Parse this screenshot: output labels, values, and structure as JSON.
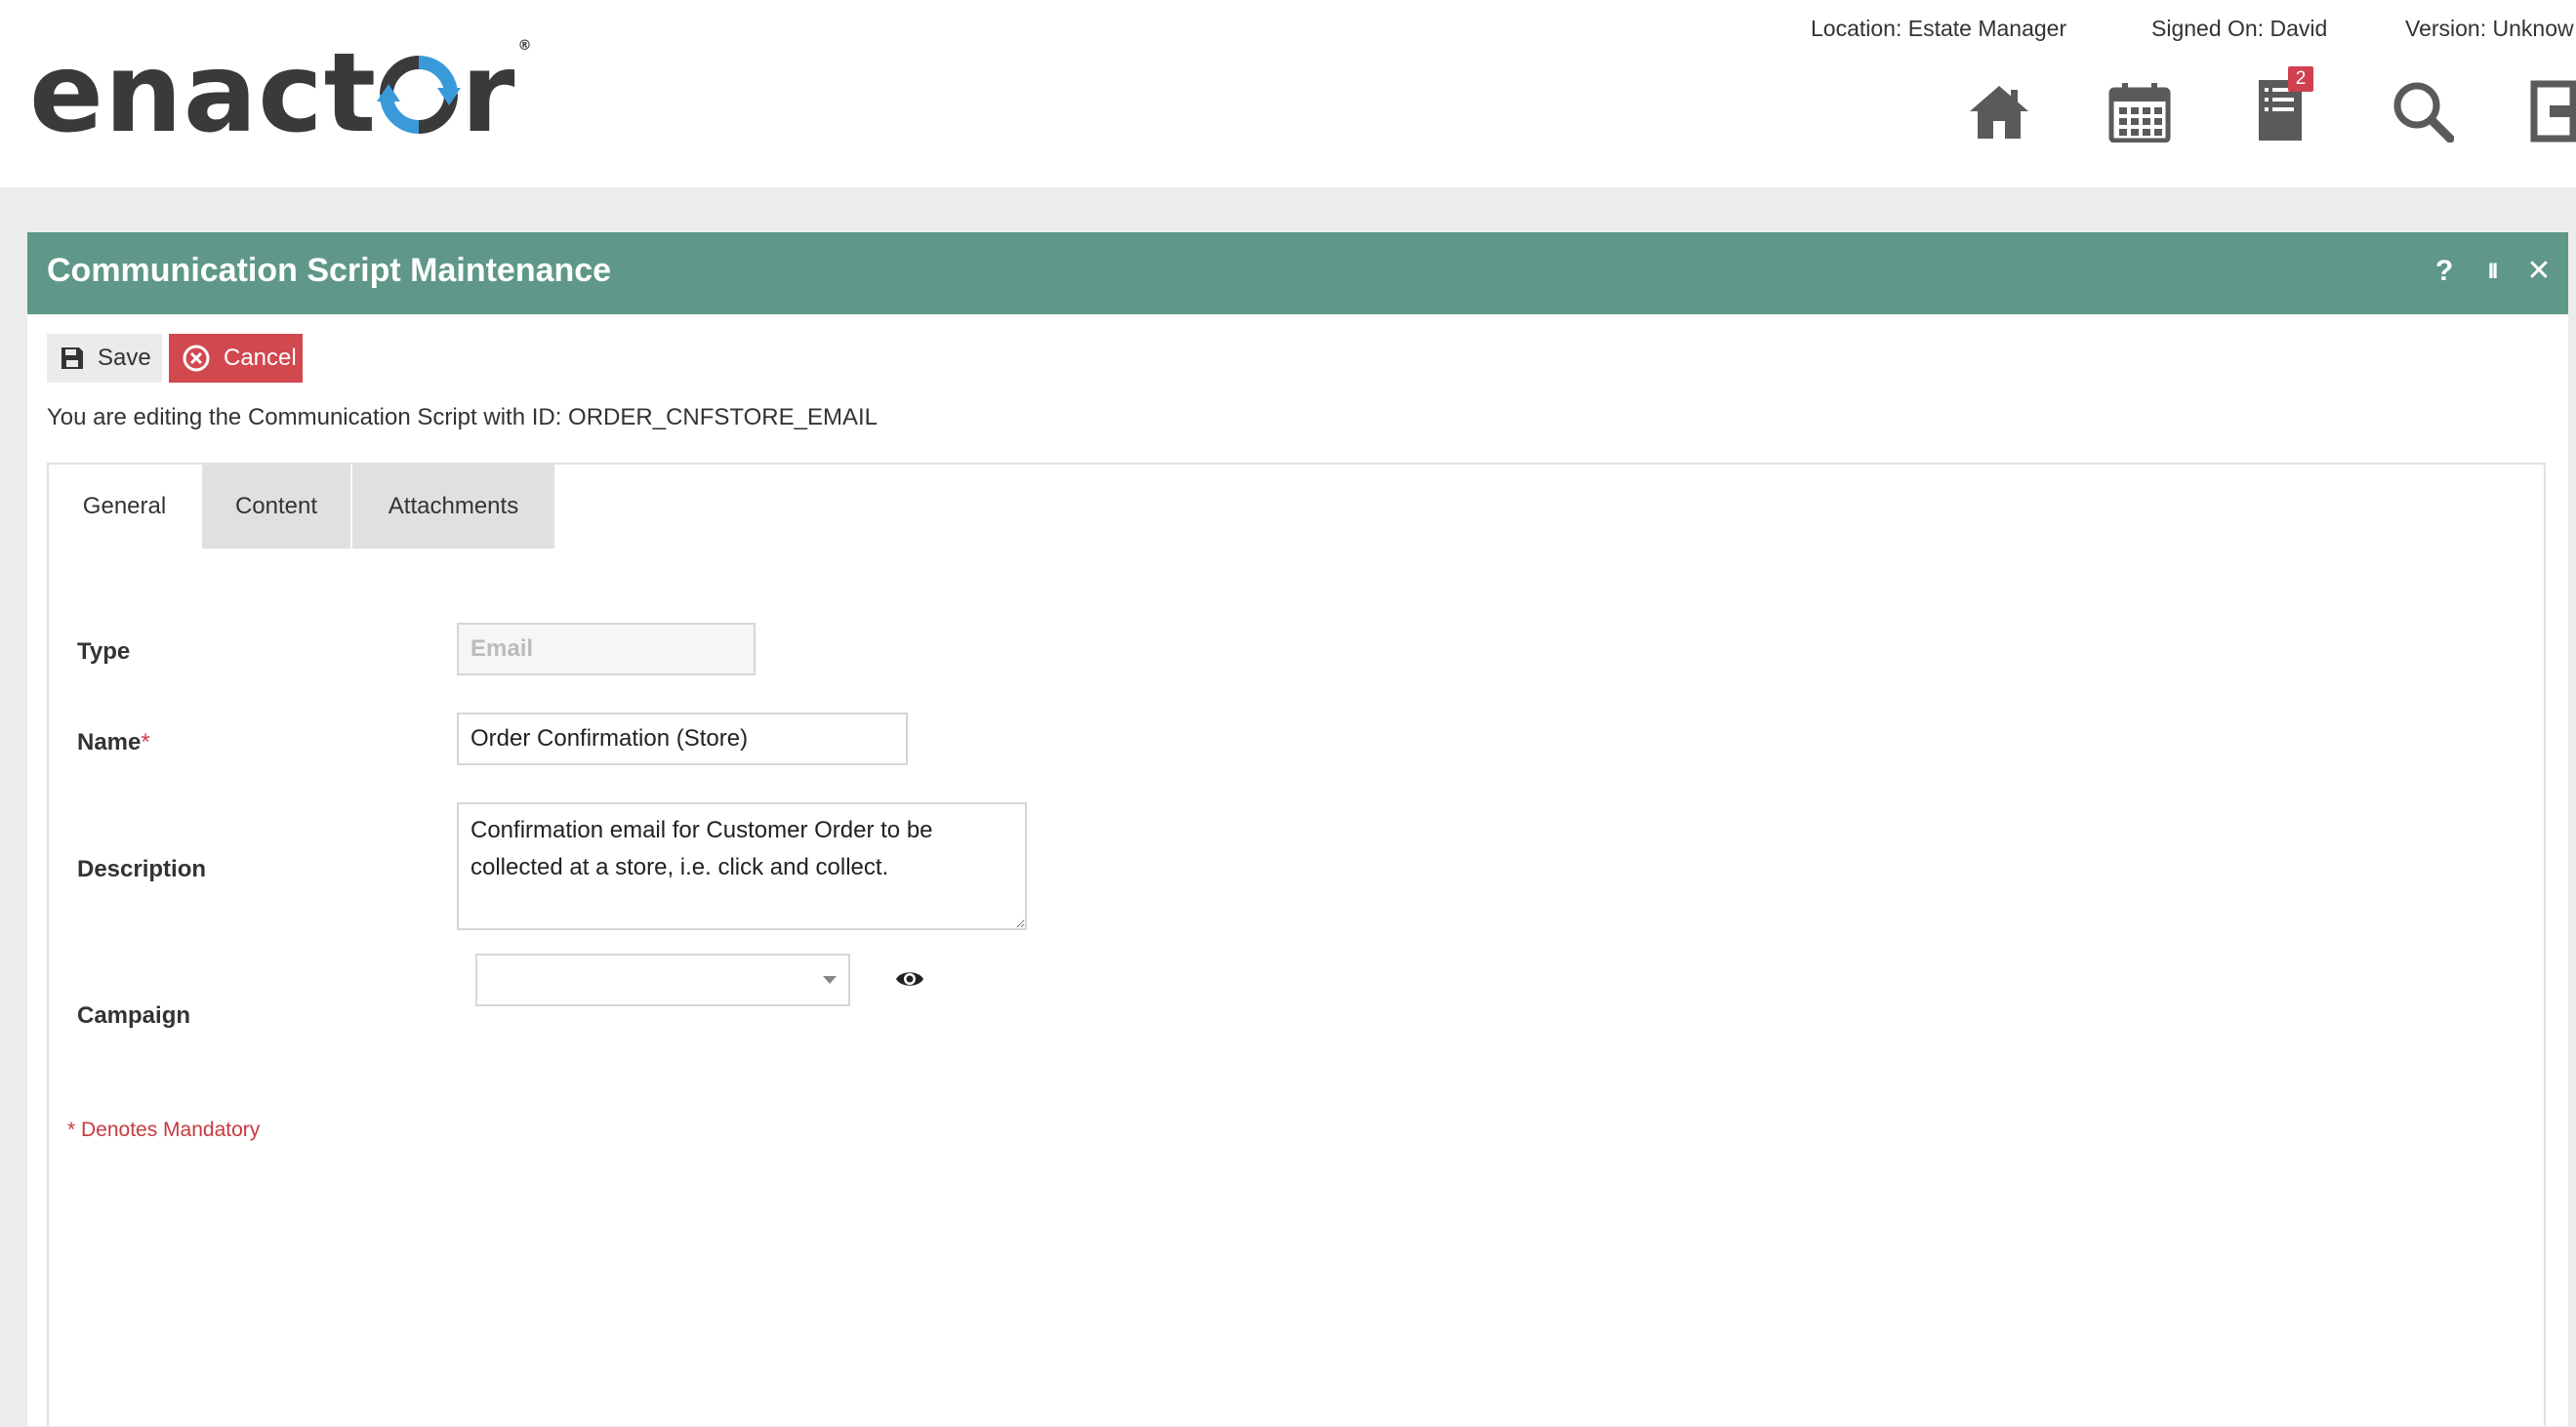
{
  "header": {
    "logo_text": "enactor",
    "location": "Location: Estate Manager",
    "signed_on": "Signed On: David",
    "version": "Version: Unknow",
    "notification_count": "2",
    "icons": [
      "home-icon",
      "calendar-icon",
      "documents-icon",
      "search-icon",
      "logout-icon"
    ]
  },
  "panel": {
    "title": "Communication Script Maintenance",
    "controls": {
      "help": "?",
      "pause": "II",
      "close": "✕"
    }
  },
  "toolbar": {
    "save_label": "Save",
    "cancel_label": "Cancel"
  },
  "edit_message": "You are editing the Communication Script with ID: ORDER_CNFSTORE_EMAIL",
  "tabs": [
    {
      "label": "General",
      "active": true
    },
    {
      "label": "Content",
      "active": false
    },
    {
      "label": "Attachments",
      "active": false
    }
  ],
  "form": {
    "type_label": "Type",
    "type_value": "Email",
    "name_label": "Name",
    "required_marker": "*",
    "name_value": "Order Confirmation (Store)",
    "description_label": "Description",
    "description_value": "Confirmation email for Customer Order to be collected at a store, i.e. click and collect.",
    "campaign_label": "Campaign",
    "campaign_value": ""
  },
  "mandatory_note": "* Denotes Mandatory",
  "colors": {
    "titlebar": "#5f9888",
    "cancel": "#d2484f",
    "required": "#d0404f",
    "badge": "#d0404f",
    "icon": "#5a5a5a",
    "logo_accent": "#3a9ad9"
  }
}
